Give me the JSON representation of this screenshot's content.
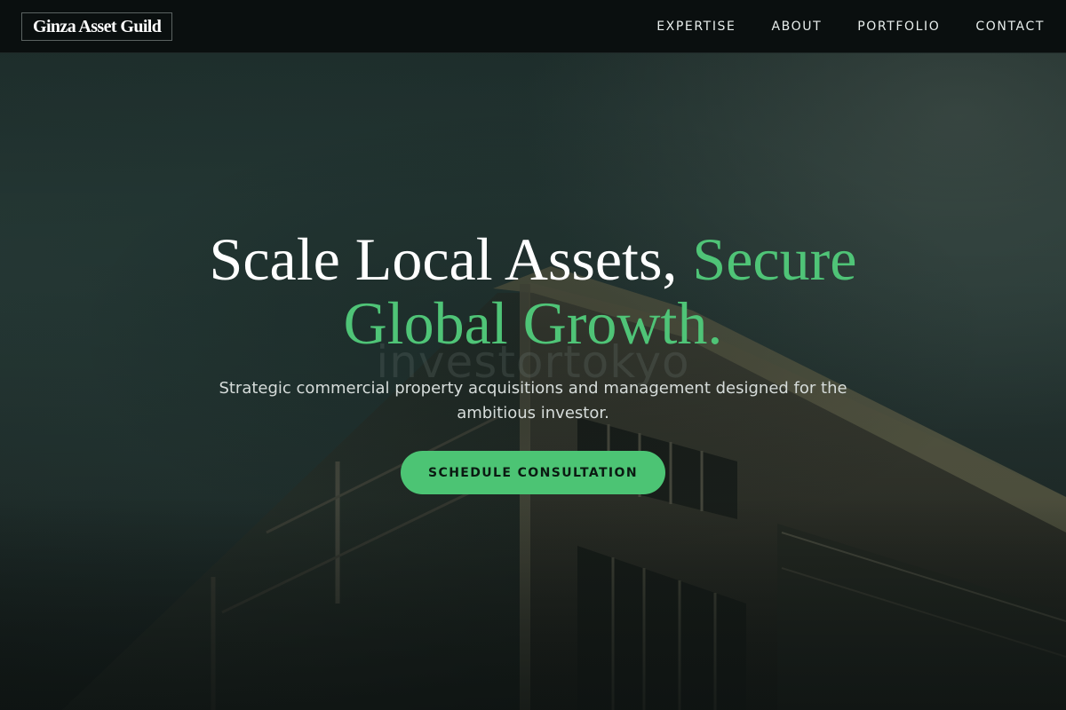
{
  "brand": {
    "name": "Ginza Asset Guild"
  },
  "nav": {
    "items": [
      {
        "label": "EXPERTISE"
      },
      {
        "label": "ABOUT"
      },
      {
        "label": "PORTFOLIO"
      },
      {
        "label": "CONTACT"
      }
    ]
  },
  "hero": {
    "headline_main": "Scale Local Assets, ",
    "headline_accent": "Secure Global Growth.",
    "watermark": "investortokyo",
    "subtitle": "Strategic commercial property acquisitions and management designed for the ambitious investor.",
    "cta_label": "SCHEDULE CONSULTATION",
    "background_image": "building-photo"
  },
  "colors": {
    "accent": "#4fc477",
    "button": "#4cc474",
    "navbar_bg": "#0a0f0f",
    "hero_bg": "#223532",
    "text_primary": "#ffffff",
    "text_secondary": "#d6dcda"
  }
}
